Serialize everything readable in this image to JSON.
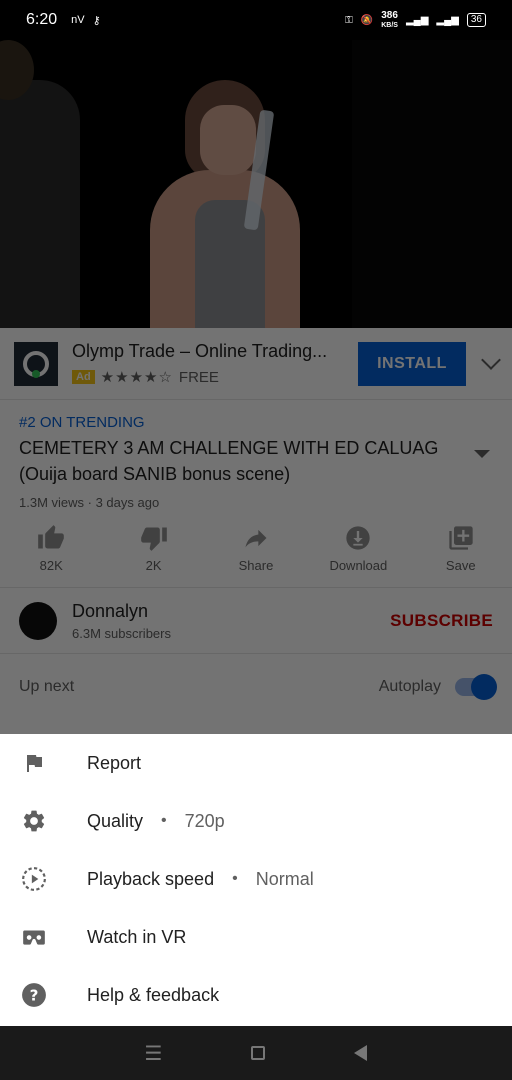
{
  "status_bar": {
    "time": "6:20",
    "net_speed": "386",
    "net_unit": "KB/S",
    "battery": "36"
  },
  "ad": {
    "title": "Olymp Trade – Online Trading...",
    "badge": "Ad",
    "stars": "★★★★☆",
    "price": "FREE",
    "install_label": "INSTALL"
  },
  "video": {
    "trending": "#2 ON TRENDING",
    "title": "CEMETERY 3 AM CHALLENGE WITH ED CALUAG (Ouija board SANIB bonus scene)",
    "meta": "1.3M views · 3 days ago"
  },
  "actions": {
    "likes": "82K",
    "dislikes": "2K",
    "share": "Share",
    "download": "Download",
    "save": "Save"
  },
  "channel": {
    "name": "Donnalyn",
    "subscribers": "6.3M subscribers",
    "subscribe_label": "SUBSCRIBE"
  },
  "up_next": {
    "label": "Up next",
    "autoplay_label": "Autoplay",
    "autoplay_on": true
  },
  "sheet": {
    "items": [
      {
        "label": "Report",
        "icon": "flag-icon"
      },
      {
        "label": "Quality",
        "value": "720p",
        "icon": "gear-icon"
      },
      {
        "label": "Playback speed",
        "value": "Normal",
        "icon": "playback-speed-icon"
      },
      {
        "label": "Watch in VR",
        "icon": "vr-icon"
      },
      {
        "label": "Help & feedback",
        "icon": "help-icon"
      }
    ],
    "separator": "•"
  },
  "colors": {
    "accent_blue": "#065fd4",
    "subscribe_red": "#cc0000"
  }
}
